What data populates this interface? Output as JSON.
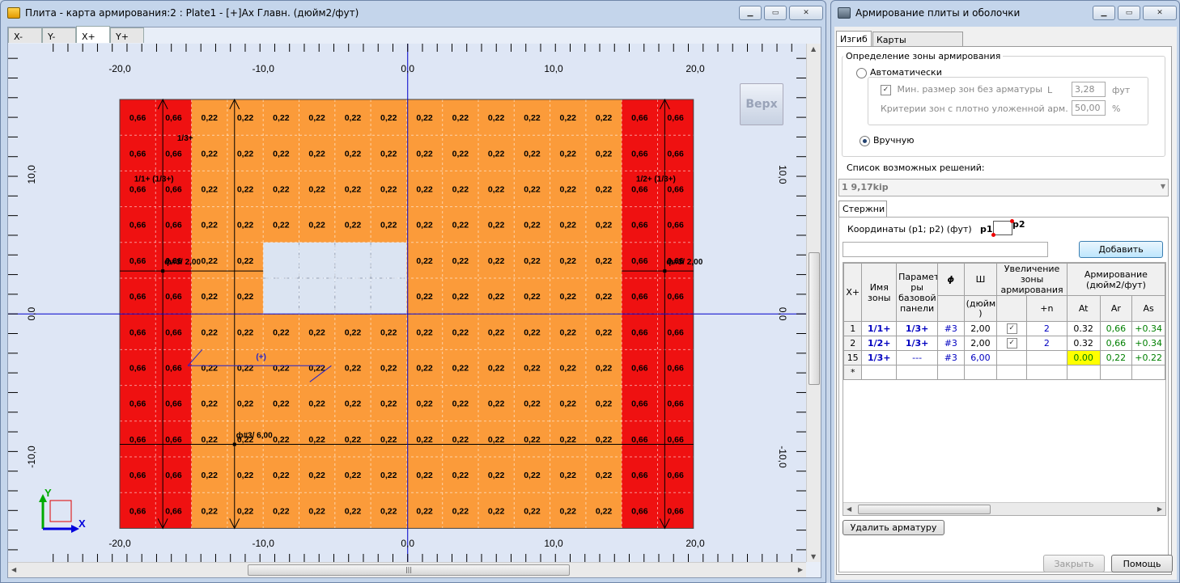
{
  "left_window": {
    "title": "Плита - карта армирования:2 : Plate1 - [+]Ax Главн. (дюйм2/фут)",
    "view_tabs": [
      "X-",
      "Y-",
      "X+",
      "Y+"
    ],
    "active_tab": "X+",
    "top_view_button": "Верх",
    "axis_x_labels": [
      "-20,0",
      "-10,0",
      "0,0",
      "10,0",
      "20,0"
    ],
    "axis_y_labels_left": [
      "10,0",
      "0,0",
      "-10,0"
    ],
    "axis_y_labels_right": [
      "10,0",
      "0,0",
      "-10,0"
    ],
    "triad": {
      "y": "Y",
      "x": "X"
    },
    "grid_rows": [
      [
        "0,66",
        "0,66",
        "0,22",
        "0,22",
        "0,22",
        "0,22",
        "0,22",
        "0,22",
        "0,22",
        "0,22",
        "0,22",
        "0,22",
        "0,22",
        "0,22",
        "0,66",
        "0,66"
      ],
      [
        "0,66",
        "0,66",
        "0,22",
        "0,22",
        "0,22",
        "0,22",
        "0,22",
        "0,22",
        "0,22",
        "0,22",
        "0,22",
        "0,22",
        "0,22",
        "0,22",
        "0,66",
        "0,66"
      ],
      [
        "0,66",
        "0,66",
        "0,22",
        "0,22",
        "0,22",
        "0,22",
        "0,22",
        "0,22",
        "0,22",
        "0,22",
        "0,22",
        "0,22",
        "0,22",
        "0,22",
        "0,66",
        "0,66"
      ],
      [
        "0,66",
        "0,66",
        "0,22",
        "0,22",
        "0,22",
        "0,22",
        "0,22",
        "0,22",
        "0,22",
        "0,22",
        "0,22",
        "0,22",
        "0,22",
        "0,22",
        "0,66",
        "0,66"
      ],
      [
        "0,66",
        "0,66",
        "0,22",
        "0,22",
        "",
        "",
        "",
        "",
        "0,22",
        "0,22",
        "0,22",
        "0,22",
        "0,22",
        "0,22",
        "0,66",
        "0,66"
      ],
      [
        "0,66",
        "0,66",
        "0,22",
        "0,22",
        "",
        "",
        "",
        "",
        "0,22",
        "0,22",
        "0,22",
        "0,22",
        "0,22",
        "0,22",
        "0,66",
        "0,66"
      ],
      [
        "0,66",
        "0,66",
        "0,22",
        "0,22",
        "0,22",
        "0,22",
        "0,22",
        "0,22",
        "0,22",
        "0,22",
        "0,22",
        "0,22",
        "0,22",
        "0,22",
        "0,66",
        "0,66"
      ],
      [
        "0,66",
        "0,66",
        "0,22",
        "0,22",
        "0,22",
        "0,22",
        "0,22",
        "0,22",
        "0,22",
        "0,22",
        "0,22",
        "0,22",
        "0,22",
        "0,22",
        "0,66",
        "0,66"
      ],
      [
        "0,66",
        "0,66",
        "0,22",
        "0,22",
        "0,22",
        "0,22",
        "0,22",
        "0,22",
        "0,22",
        "0,22",
        "0,22",
        "0,22",
        "0,22",
        "0,22",
        "0,66",
        "0,66"
      ],
      [
        "0,66",
        "0,66",
        "0,22",
        "0,22",
        "0,22",
        "0,22",
        "0,22",
        "0,22",
        "0,22",
        "0,22",
        "0,22",
        "0,22",
        "0,22",
        "0,22",
        "0,66",
        "0,66"
      ],
      [
        "0,66",
        "0,66",
        "0,22",
        "0,22",
        "0,22",
        "0,22",
        "0,22",
        "0,22",
        "0,22",
        "0,22",
        "0,22",
        "0,22",
        "0,22",
        "0,22",
        "0,66",
        "0,66"
      ],
      [
        "0,66",
        "0,66",
        "0,22",
        "0,22",
        "0,22",
        "0,22",
        "0,22",
        "0,22",
        "0,22",
        "0,22",
        "0,22",
        "0,22",
        "0,22",
        "0,22",
        "0,66",
        "0,66"
      ]
    ],
    "annotations": {
      "zone_13": "1/3+",
      "zone_left": "1/1+ (1/3+)",
      "zone_right": "1/2+ (1/3+)",
      "bar_left": "ф#3/ 2,00",
      "bar_right": "ф#3/ 2,00",
      "bar_bottom": "ф#3/ 6,00",
      "plus_marker": "(+)"
    },
    "colors": {
      "red_zone": "#ef1111",
      "orange_zone": "#fb9b3a",
      "opening": "#dbe4f2",
      "axis": "#0000cc",
      "background": "#dee6f5"
    }
  },
  "right_window": {
    "title": "Армирование плиты и оболочки",
    "tabs": [
      "Изгиб",
      "Карты армирования"
    ],
    "active_tab": "Изгиб",
    "zone_group_title": "Определение зоны армирования",
    "auto_option": "Автоматически",
    "min_size_label": "Мин. размер зон без арматуры",
    "min_size_param": "L",
    "min_size_value": "3,28",
    "min_size_unit": "фут",
    "dense_label": "Критерии зон с плотно уложенной арм.",
    "dense_value": "50,00",
    "dense_unit": "%",
    "manual_option": "Вручную",
    "solutions_label": "Список возможных решений:",
    "solutions_selected": "1    9,17kip",
    "bars_tab": "Стержни",
    "coords_label": "Координаты (p1; p2) (фут)",
    "p1": "p1",
    "p2": "p2",
    "coords_value": "",
    "add_button": "Добавить",
    "table_headers": {
      "col0": "X+",
      "name": "Имя зоны",
      "base": "Парамет ры базовой панели",
      "phi": "ϕ",
      "spacing": "Ш",
      "spacing_unit": "(дюйм )",
      "increase": "Увеличение зоны армирования",
      "plus_n": "+n",
      "reinf": "Армирование (дюйм2/фут)",
      "at": "At",
      "ar": "Ar",
      "as": "As"
    },
    "table_rows": [
      {
        "id": "1",
        "name": "1/1+",
        "base": "1/3+",
        "phi": "#3",
        "sp": "2,00",
        "chk": true,
        "n": "2",
        "at": "0.32",
        "ar": "0,66",
        "as": "+0.34"
      },
      {
        "id": "2",
        "name": "1/2+",
        "base": "1/3+",
        "phi": "#3",
        "sp": "2,00",
        "chk": true,
        "n": "2",
        "at": "0.32",
        "ar": "0,66",
        "as": "+0.34"
      },
      {
        "id": "15",
        "name": "1/3+",
        "base": "---",
        "phi": "#3",
        "sp": "6,00",
        "chk": false,
        "n": "",
        "at": "0.00",
        "ar": "0,22",
        "as": "+0.22"
      }
    ],
    "new_row_marker": "*",
    "delete_button": "Удалить арматуру",
    "close_button": "Закрыть",
    "help_button": "Помощь",
    "highlight_color": "#ffff00"
  }
}
